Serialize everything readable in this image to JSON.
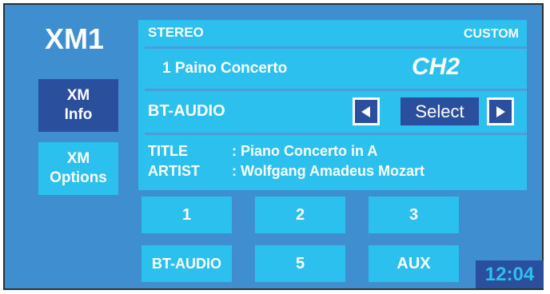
{
  "header": {
    "title": "XM1"
  },
  "sidebar": {
    "items": [
      {
        "label": "XM\nInfo"
      },
      {
        "label": "XM\nOptions"
      }
    ]
  },
  "info": {
    "audio_mode": "STEREO",
    "eq_mode": "CUSTOM",
    "track": "1  Paino Concerto",
    "channel": "CH2",
    "source": "BT-AUDIO",
    "select_label": "Select",
    "title_key": "TITLE",
    "title_value": ": Piano Concerto in A",
    "artist_key": "ARTIST",
    "artist_value": ": Wolfgang Amadeus Mozart"
  },
  "presets": [
    "1",
    "2",
    "3",
    "BT-AUDIO",
    "5",
    "AUX"
  ],
  "clock": "12:04",
  "colors": {
    "background": "#3f8fd0",
    "panel": "#2cc0ee",
    "dark_accent": "#2a4f9c",
    "text": "#ffffff"
  },
  "icons": {
    "prev": "triangle-left-icon",
    "next": "triangle-right-icon"
  }
}
